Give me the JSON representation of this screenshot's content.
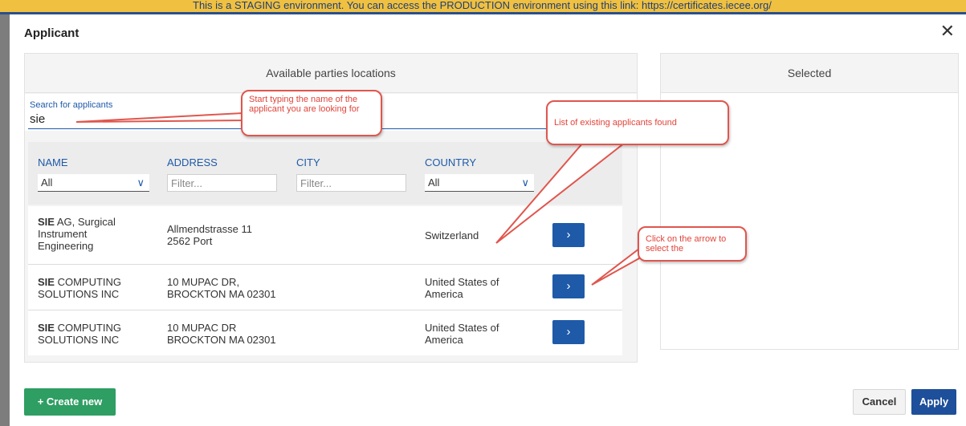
{
  "staging_banner": "This is a STAGING environment. You can access the PRODUCTION environment using this link: https://certificates.iecee.org/",
  "dialog": {
    "title": "Applicant",
    "close_label": "✕"
  },
  "left_panel": {
    "header": "Available parties locations",
    "search": {
      "label": "Search for applicants",
      "value": "sie"
    },
    "columns": {
      "name": "NAME",
      "address": "ADDRESS",
      "city": "CITY",
      "country": "COUNTRY"
    },
    "filters": {
      "name_select": "All",
      "address_placeholder": "Filter...",
      "city_placeholder": "Filter...",
      "country_select": "All"
    },
    "rows": [
      {
        "name_bold": "SIE",
        "name_rest": " AG, Surgical Instrument Engineering",
        "address_line1": "Allmendstrasse 11",
        "address_line2": "2562 Port",
        "city": "",
        "country": "Switzerland",
        "select_label": "›"
      },
      {
        "name_bold": "SIE",
        "name_rest": " COMPUTING SOLUTIONS INC",
        "address_line1": "10 MUPAC DR,",
        "address_line2": "BROCKTON MA 02301",
        "city": "",
        "country": "United States of America",
        "select_label": "›"
      },
      {
        "name_bold": "SIE",
        "name_rest": " COMPUTING SOLUTIONS INC",
        "address_line1": "10 MUPAC DR",
        "address_line2": "BROCKTON MA 02301",
        "city": "",
        "country": "United States of America",
        "select_label": "›"
      }
    ]
  },
  "right_panel": {
    "header": "Selected"
  },
  "footer": {
    "create_label": "+ Create new",
    "cancel_label": "Cancel",
    "apply_label": "Apply"
  },
  "callouts": {
    "search_hint": "Start typing the name of the applicant you are looking for",
    "list_hint": "List of existing applicants found",
    "arrow_hint": "Click on the arrow to select the"
  },
  "colors": {
    "accent": "#1e5aa8",
    "create_green": "#2e9e63",
    "callout_red": "#e0443a"
  }
}
